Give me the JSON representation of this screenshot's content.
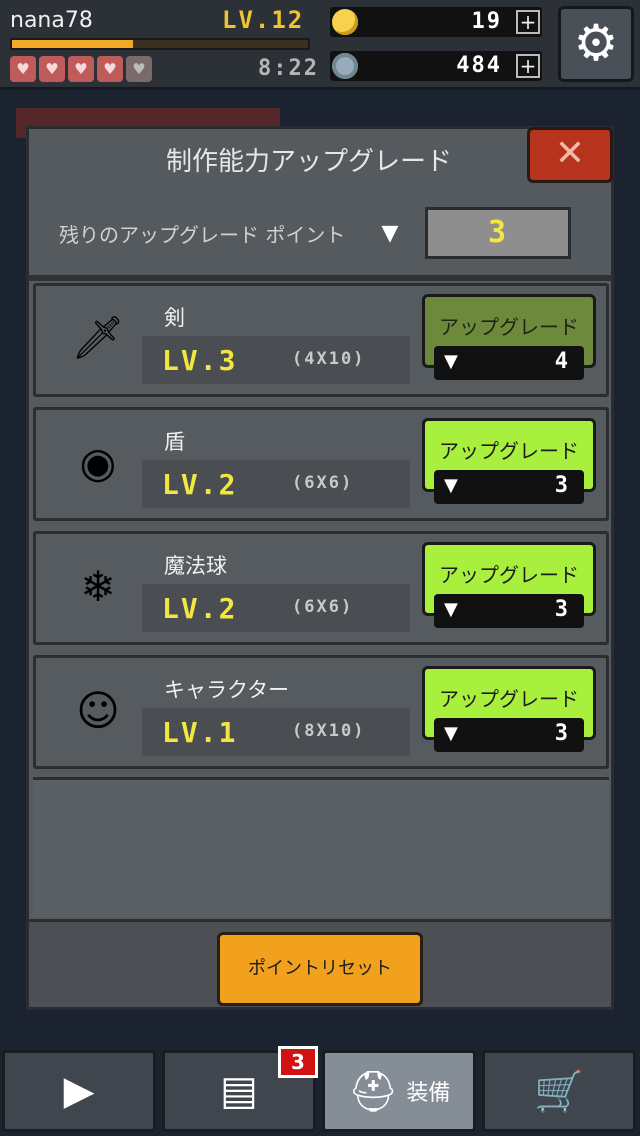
{
  "hud": {
    "username": "nana78",
    "level": "LV.12",
    "xp_fraction": 0.41,
    "time": "8:22",
    "gold": "19",
    "gems": "484",
    "plus": "+"
  },
  "dialog": {
    "title": "制作能力アップグレード",
    "close": "✕",
    "points_label": "残りのアップグレード ポイント",
    "points_value": "3",
    "reset_label": "ポイントリセット"
  },
  "items": [
    {
      "name": "剣",
      "level": "LV.3",
      "dims": "(4X10)",
      "button": "アップグレード",
      "cost": "4",
      "enabled": false,
      "icon": "sword-icon",
      "glyph": "🗡"
    },
    {
      "name": "盾",
      "level": "LV.2",
      "dims": "(6X6)",
      "button": "アップグレード",
      "cost": "3",
      "enabled": true,
      "icon": "shield-icon",
      "glyph": "◉"
    },
    {
      "name": "魔法球",
      "level": "LV.2",
      "dims": "(6X6)",
      "button": "アップグレード",
      "cost": "3",
      "enabled": true,
      "icon": "magic-orb-icon",
      "glyph": "❄"
    },
    {
      "name": "キャラクター",
      "level": "LV.1",
      "dims": "(8X10)",
      "button": "アップグレード",
      "cost": "3",
      "enabled": true,
      "icon": "character-icon",
      "glyph": "☺"
    }
  ],
  "nav": {
    "chest_badge": "3",
    "equip_label": "装備"
  },
  "colors": {
    "upgrade_enabled": "#a9ef3e",
    "upgrade_disabled": "#6d8a3c",
    "level_text": "#f2e640",
    "reset_button": "#f2a11e"
  }
}
